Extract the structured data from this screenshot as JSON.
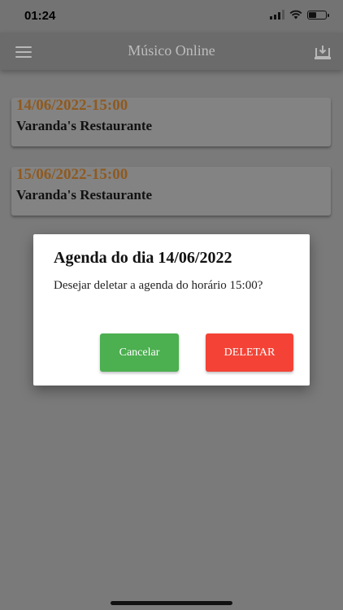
{
  "status_bar": {
    "time": "01:24",
    "battery_level": 0.45
  },
  "app_bar": {
    "title": "Músico Online",
    "menu_icon": "menu-icon",
    "action_icon": "download-icon"
  },
  "agenda_items": [
    {
      "date": "14/06/2022-15:00",
      "place": "Varanda's Restaurante"
    },
    {
      "date": "15/06/2022-15:00",
      "place": "Varanda's Restaurante"
    }
  ],
  "dialog": {
    "title": "Agenda do dia 14/06/2022",
    "message": "Desejar deletar a agenda do horário 15:00?",
    "cancel_label": "Cancelar",
    "delete_label": "DELETAR"
  },
  "colors": {
    "date_text": "#8f5a20",
    "cancel_button": "#4caf50",
    "delete_button": "#f44336"
  }
}
